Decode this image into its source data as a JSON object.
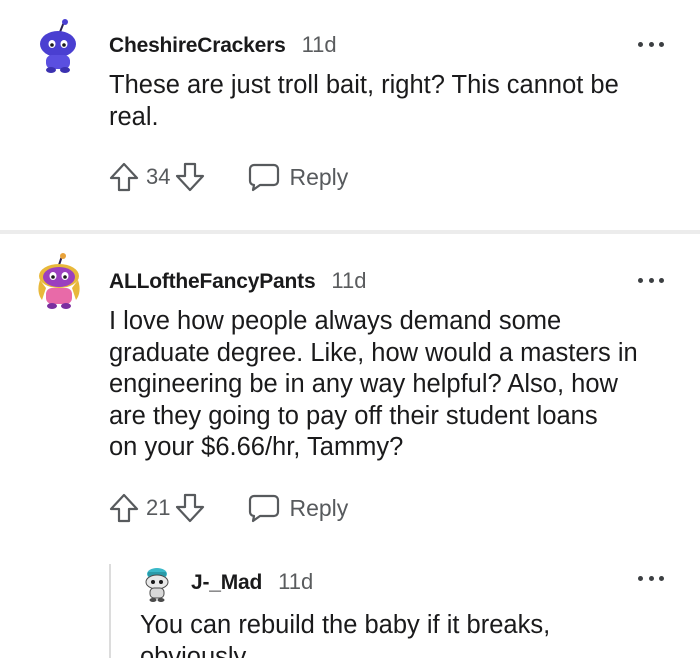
{
  "comments": [
    {
      "username": "CheshireCrackers",
      "time": "11d",
      "body_lines": [
        "These are just troll bait, right? This cannot be",
        "real."
      ],
      "score": "34",
      "reply_label": "Reply",
      "avatar_color": "#4a3fd1"
    },
    {
      "username": "ALLoftheFancyPants",
      "time": "11d",
      "body_lines": [
        "I love how people always demand some",
        "graduate degree. Like, how would a masters in",
        "engineering be in any way helpful? Also, how",
        "are they going to pay off their student loans",
        "on your $6.66/hr, Tammy?"
      ],
      "score": "21",
      "reply_label": "Reply",
      "avatar_color": "#9b3fbf"
    },
    {
      "username": "J-_Mad",
      "time": "11d",
      "body_lines": [
        "You can rebuild the baby if it breaks,",
        "obviously."
      ]
    }
  ],
  "icons": {
    "upvote": "arrow-up-outline-icon",
    "downvote": "arrow-down-outline-icon",
    "reply": "speech-bubble-icon",
    "more": "ellipsis-icon"
  }
}
